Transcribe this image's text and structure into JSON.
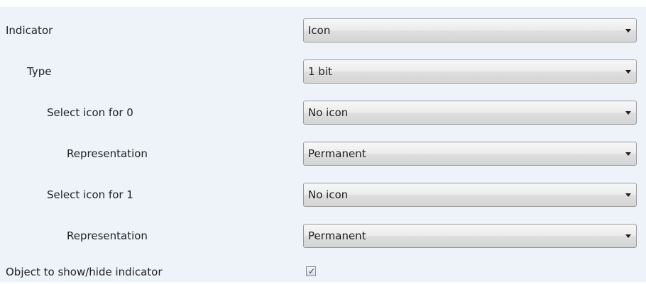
{
  "parameters": {
    "indicator": {
      "label": "Indicator",
      "value": "Icon"
    },
    "type": {
      "label": "Type",
      "value": "1 bit"
    },
    "select_icon_0": {
      "label": "Select icon for 0",
      "value": "No icon"
    },
    "representation_0": {
      "label": "Representation",
      "value": "Permanent"
    },
    "select_icon_1": {
      "label": "Select icon for 1",
      "value": "No icon"
    },
    "representation_1": {
      "label": "Representation",
      "value": "Permanent"
    },
    "object_show_hide": {
      "label": "Object to show/hide indicator",
      "checked": true,
      "check_glyph": "✓"
    }
  },
  "icons": {
    "dropdown_arrow": "chevron-down-icon",
    "checkbox_mark": "checkmark-icon"
  },
  "colors": {
    "panel_background": "#eef3fa",
    "checkmark": "#1d3d8f"
  }
}
